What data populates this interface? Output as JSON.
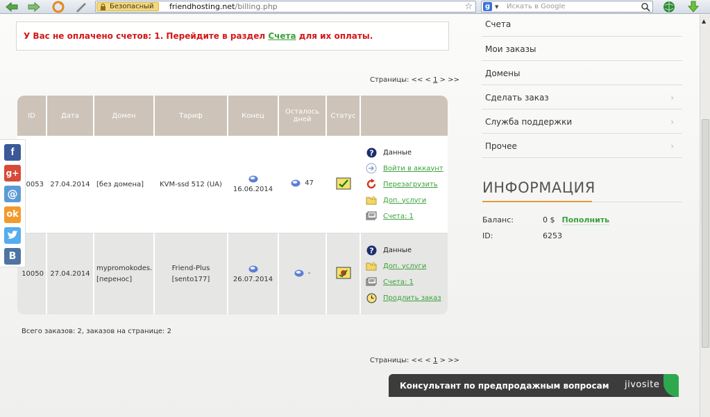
{
  "browser": {
    "secure_label": "Безопасный",
    "url_host": "friendhosting.net",
    "url_path": "/billing.php",
    "search_placeholder": "Искать в Google"
  },
  "alert": {
    "text_before": "У Вас не оплачено счетов: 1. Перейдите в раздел ",
    "link": "Счета",
    "text_after": " для их оплаты."
  },
  "pager": {
    "label": "Страницы:",
    "prev": "<< <",
    "current": "1",
    "next": "> >>"
  },
  "table": {
    "headers": [
      "ID",
      "Дата",
      "Домен",
      "Тариф",
      "Конец",
      "Осталось дней",
      "Статус"
    ],
    "rows": [
      {
        "id": "10053",
        "date": "27.04.2014",
        "domain": "[без домена]",
        "domain2": "",
        "tariff": "KVM-ssd 512 (UA)",
        "tariff2": "",
        "end": "16.06.2014",
        "days": "47",
        "actions": [
          "Данные",
          "Войти в аккаунт",
          "Перезагрузить",
          "Доп. услуги",
          "Счета: 1"
        ]
      },
      {
        "id": "10050",
        "date": "27.04.2014",
        "domain": "mypromokodes.",
        "domain2": "[перенос]",
        "tariff": "Friend-Plus",
        "tariff2": "[sento177]",
        "end": "26.07.2014",
        "days": "-",
        "actions": [
          "Данные",
          "Доп. услуги",
          "Счета: 1",
          "Продлить заказ"
        ]
      }
    ]
  },
  "summary": "Всего заказов: 2, заказов на странице: 2",
  "sidebar": {
    "items": [
      "Счета",
      "Мои заказы",
      "Домены",
      "Сделать заказ",
      "Служба поддержки",
      "Прочее"
    ]
  },
  "info": {
    "title": "ИНФОРМАЦИЯ",
    "balance_label": "Баланс:",
    "balance_value": "0 $",
    "topup": "Пополнить",
    "id_label": "ID:",
    "id_value": "6253"
  },
  "jivo": {
    "text": "Консультант по предпродажным вопросам",
    "logo": "jivosite"
  },
  "colors": {
    "alert": "#d21818",
    "link": "#3aa13a",
    "header": "#cdc3b8",
    "accent": "#e89a35"
  }
}
